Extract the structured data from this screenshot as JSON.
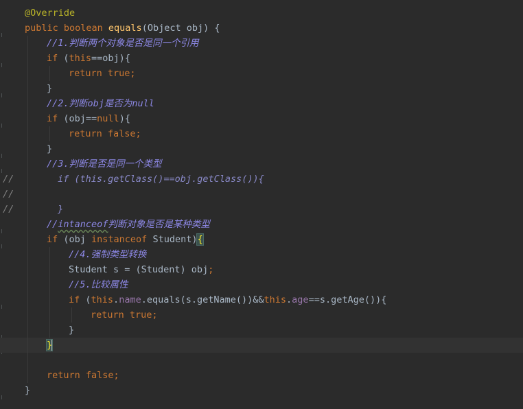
{
  "editor": {
    "lines": [
      {
        "id": "l1",
        "parts": [
          {
            "t": "@Override",
            "c": "ann"
          }
        ]
      },
      {
        "id": "l2",
        "parts": [
          {
            "t": "public boolean ",
            "c": "kw"
          },
          {
            "t": "equals",
            "c": "fn"
          },
          {
            "t": "(Object obj) {",
            "c": ""
          }
        ]
      },
      {
        "id": "l3",
        "parts": [
          {
            "t": "//1.判断两个对象是否是同一个引用",
            "c": "cmt"
          }
        ]
      },
      {
        "id": "l4",
        "parts": [
          {
            "t": "if ",
            "c": "kw"
          },
          {
            "t": "(",
            "c": ""
          },
          {
            "t": "this",
            "c": "kw"
          },
          {
            "t": "==obj){",
            "c": ""
          }
        ]
      },
      {
        "id": "l5",
        "parts": [
          {
            "t": "return true;",
            "c": "kw"
          }
        ]
      },
      {
        "id": "l6",
        "parts": [
          {
            "t": "}",
            "c": ""
          }
        ]
      },
      {
        "id": "l7",
        "parts": [
          {
            "t": "//2.判断obj是否为null",
            "c": "cmt"
          }
        ]
      },
      {
        "id": "l8",
        "parts": [
          {
            "t": "if ",
            "c": "kw"
          },
          {
            "t": "(obj==",
            "c": ""
          },
          {
            "t": "null",
            "c": "kw"
          },
          {
            "t": "){",
            "c": ""
          }
        ]
      },
      {
        "id": "l9",
        "parts": [
          {
            "t": "return false;",
            "c": "kw"
          }
        ]
      },
      {
        "id": "l10",
        "parts": [
          {
            "t": "}",
            "c": ""
          }
        ]
      },
      {
        "id": "l11",
        "parts": [
          {
            "t": "//3.判断是否是同一个类型",
            "c": "cmt"
          }
        ]
      },
      {
        "id": "l12",
        "prefix": "//",
        "parts": [
          {
            "t": "if (this.getClass()==obj.getClass()){",
            "c": "cmt-dis"
          }
        ]
      },
      {
        "id": "l13",
        "prefix": "//",
        "parts": []
      },
      {
        "id": "l14",
        "prefix": "//",
        "parts": [
          {
            "t": "}",
            "c": "cmt-dis"
          }
        ]
      },
      {
        "id": "l15",
        "parts": [
          {
            "t": "//",
            "c": "cmt"
          },
          {
            "t": "intanceof",
            "c": "cmt squiggle"
          },
          {
            "t": "判断对象是否是某种类型",
            "c": "cmt"
          }
        ]
      },
      {
        "id": "l16",
        "parts": [
          {
            "t": "if ",
            "c": "kw"
          },
          {
            "t": "(obj ",
            "c": ""
          },
          {
            "t": "instanceof ",
            "c": "kw"
          },
          {
            "t": "Student)",
            "c": ""
          },
          {
            "t": "{",
            "c": "brace-hl"
          }
        ]
      },
      {
        "id": "l17",
        "parts": [
          {
            "t": "//4.强制类型转换",
            "c": "cmt"
          }
        ]
      },
      {
        "id": "l18",
        "parts": [
          {
            "t": "Student s = (Student) obj",
            "c": ""
          },
          {
            "t": ";",
            "c": "kw"
          }
        ]
      },
      {
        "id": "l19",
        "parts": [
          {
            "t": "//5.比较属性",
            "c": "cmt"
          }
        ]
      },
      {
        "id": "l20",
        "parts": [
          {
            "t": "if ",
            "c": "kw"
          },
          {
            "t": "(",
            "c": ""
          },
          {
            "t": "this",
            "c": "kw"
          },
          {
            "t": ".",
            "c": ""
          },
          {
            "t": "name",
            "c": "fld"
          },
          {
            "t": ".equals(s.getName())&&",
            "c": ""
          },
          {
            "t": "this",
            "c": "kw"
          },
          {
            "t": ".",
            "c": ""
          },
          {
            "t": "age",
            "c": "fld"
          },
          {
            "t": "==s.getAge()){",
            "c": ""
          }
        ]
      },
      {
        "id": "l21",
        "parts": [
          {
            "t": "return true;",
            "c": "kw"
          }
        ]
      },
      {
        "id": "l22",
        "parts": [
          {
            "t": "}",
            "c": ""
          }
        ]
      },
      {
        "id": "l23",
        "parts": [
          {
            "t": "}",
            "c": "brace-hl"
          }
        ]
      },
      {
        "id": "l24",
        "parts": []
      },
      {
        "id": "l25",
        "parts": [
          {
            "t": "return false;",
            "c": "kw"
          }
        ]
      },
      {
        "id": "l26",
        "parts": [
          {
            "t": "}",
            "c": ""
          }
        ]
      }
    ]
  },
  "colors": {
    "background": "#2b2b2b",
    "current_line": "#323232",
    "keyword": "#cc7832",
    "annotation": "#bbb529",
    "method": "#ffc66d",
    "field": "#9876aa",
    "comment": "#8d88e6",
    "brace_match": "#ffef28"
  }
}
